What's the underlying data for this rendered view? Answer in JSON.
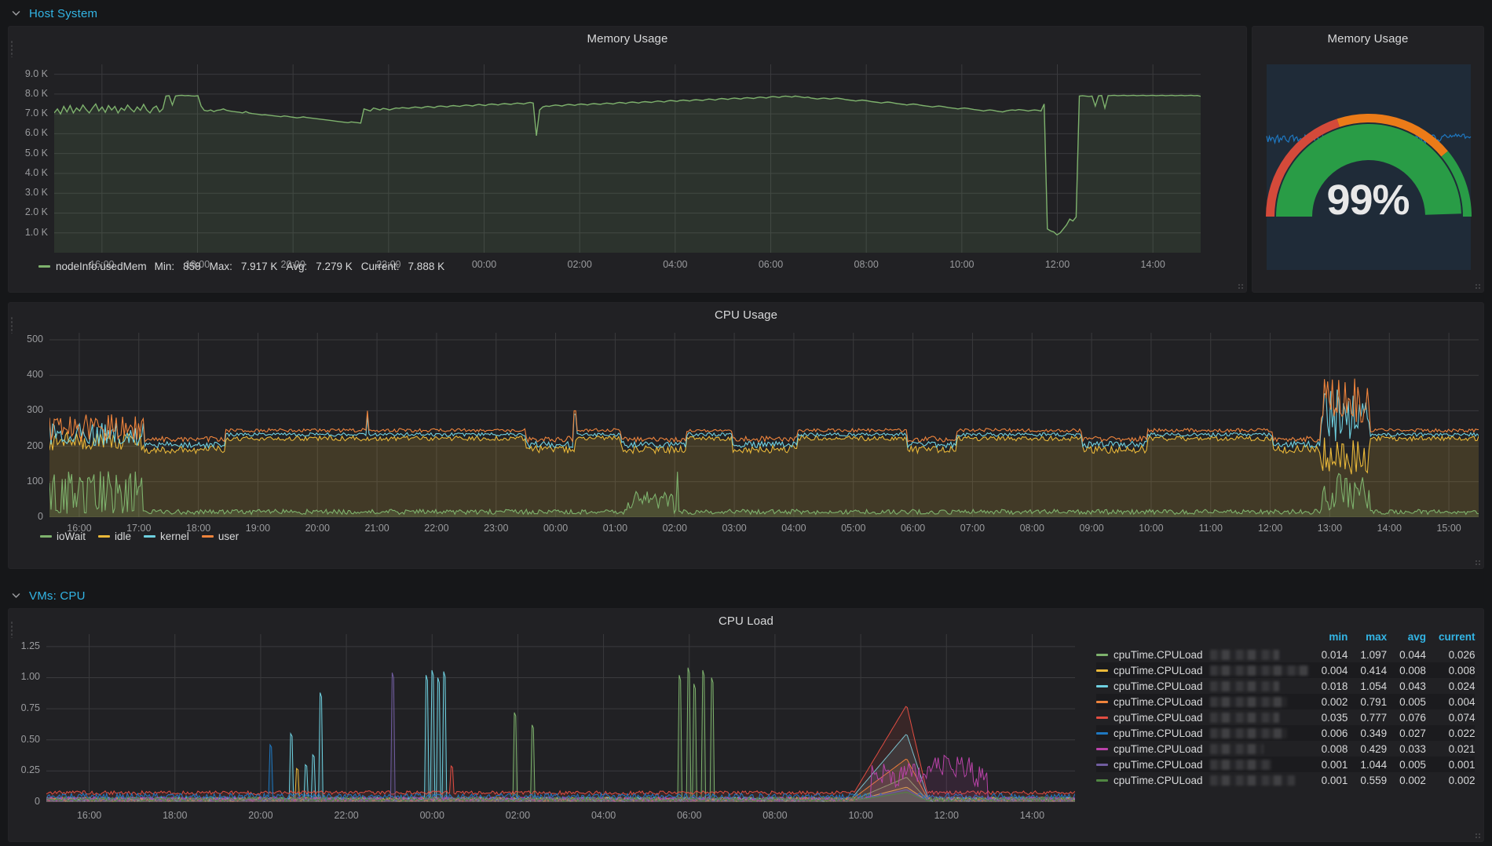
{
  "rows": [
    {
      "title": "Host System",
      "icon": "chevron-down-icon"
    },
    {
      "title": "VMs: CPU",
      "icon": "chevron-down-icon"
    }
  ],
  "panels": {
    "memory_graph": {
      "title": "Memory Usage",
      "legend": {
        "series": "nodeInfo.usedMem",
        "color": "#7eb26d",
        "min_label": "Min:",
        "min": "858",
        "max_label": "Max:",
        "max": "7.917 K",
        "avg_label": "Avg:",
        "avg": "7.279 K",
        "current_label": "Current:",
        "current": "7.888 K"
      }
    },
    "memory_gauge": {
      "title": "Memory Usage",
      "value": "99%",
      "percent": 99,
      "colors": {
        "ok": "#299c46",
        "warn": "#eb7b18",
        "crit": "#d44a3a",
        "background": "#1f2b38"
      }
    },
    "cpu_usage": {
      "title": "CPU Usage",
      "legend": [
        {
          "label": "ioWait",
          "color": "#7eb26d"
        },
        {
          "label": "idle",
          "color": "#eab839"
        },
        {
          "label": "kernel",
          "color": "#6ed0e0"
        },
        {
          "label": "user",
          "color": "#ef843c"
        }
      ]
    },
    "cpu_load": {
      "title": "CPU Load",
      "legend_headers": [
        "min",
        "max",
        "avg",
        "current"
      ],
      "legend_series_prefix": "cpuTime.CPULoad",
      "legend_rows": [
        {
          "prefix": "cpuTime.CPULoad",
          "redacted_width": 88,
          "color": "#7eb26d",
          "min": "0.014",
          "max": "1.097",
          "avg": "0.044",
          "current": "0.026"
        },
        {
          "prefix": "cpuTime.CPULoad",
          "redacted_width": 126,
          "color": "#eab839",
          "min": "0.004",
          "max": "0.414",
          "avg": "0.008",
          "current": "0.008"
        },
        {
          "prefix": "cpuTime.CPULoad",
          "redacted_width": 88,
          "color": "#6ed0e0",
          "min": "0.018",
          "max": "1.054",
          "avg": "0.043",
          "current": "0.024"
        },
        {
          "prefix": "cpuTime.CPULoad",
          "redacted_width": 98,
          "color": "#ef843c",
          "min": "0.002",
          "max": "0.791",
          "avg": "0.005",
          "current": "0.004"
        },
        {
          "prefix": "cpuTime.CPULoad",
          "redacted_width": 88,
          "color": "#e24d42",
          "min": "0.035",
          "max": "0.777",
          "avg": "0.076",
          "current": "0.074"
        },
        {
          "prefix": "cpuTime.CPULoad",
          "redacted_width": 98,
          "color": "#1f78c1",
          "min": "0.006",
          "max": "0.349",
          "avg": "0.027",
          "current": "0.022"
        },
        {
          "prefix": "cpuTime.CPULoad",
          "redacted_width": 68,
          "color": "#ba43a9",
          "min": "0.008",
          "max": "0.429",
          "avg": "0.033",
          "current": "0.021"
        },
        {
          "prefix": "cpuTime.CPULoad",
          "redacted_width": 78,
          "color": "#705da0",
          "min": "0.001",
          "max": "1.044",
          "avg": "0.005",
          "current": "0.001"
        },
        {
          "prefix": "cpuTime.CPULoad",
          "redacted_width": 108,
          "color": "#508642",
          "min": "0.001",
          "max": "0.559",
          "avg": "0.002",
          "current": "0.002"
        }
      ]
    }
  },
  "chart_data": [
    {
      "id": "memory_graph",
      "type": "line",
      "title": "Memory Usage",
      "ylabel": "",
      "xlabel": "",
      "ylim": [
        0,
        9500
      ],
      "ytick_labels": [
        "9.0 K",
        "8.0 K",
        "7.0 K",
        "6.0 K",
        "5.0 K",
        "4.0 K",
        "3.0 K",
        "2.0 K",
        "1.0 K"
      ],
      "ytick_values": [
        9000,
        8000,
        7000,
        6000,
        5000,
        4000,
        3000,
        2000,
        1000
      ],
      "xtick_labels": [
        "16:00",
        "18:00",
        "20:00",
        "22:00",
        "00:00",
        "02:00",
        "04:00",
        "06:00",
        "08:00",
        "10:00",
        "12:00",
        "14:00"
      ],
      "grid": true,
      "legend_position": "bottom",
      "series": [
        {
          "name": "nodeInfo.usedMem",
          "color": "#7eb26d",
          "fill": true,
          "values": [
            7050,
            7250,
            7000,
            7380,
            7100,
            7420,
            7050,
            7300,
            7150,
            7450,
            7220,
            7050,
            7300,
            7500,
            7150,
            7350,
            7080,
            7420,
            7200,
            7380,
            7050,
            7300,
            7180,
            7450,
            7250,
            7100,
            7350,
            7180,
            7480,
            7200,
            7050,
            7300,
            7400,
            7100,
            7250,
            7900,
            7920,
            7450,
            7900,
            7930,
            7940,
            7920,
            7930,
            7910,
            7900,
            7920,
            7400,
            7180,
            7150,
            7200,
            7120,
            7180,
            7200,
            7250,
            7180,
            7150,
            7120,
            7100,
            7080,
            7050,
            7120,
            7050,
            7020,
            7000,
            6980,
            6950,
            6960,
            6940,
            6920,
            6900,
            6880,
            6860,
            6900,
            6880,
            6850,
            6830,
            6800,
            6820,
            6850,
            6820,
            6800,
            6780,
            6760,
            6740,
            6720,
            6700,
            6680,
            6660,
            6640,
            6620,
            6600,
            6580,
            6560,
            6600,
            6580,
            6560,
            6540,
            7250,
            7200,
            7150,
            7300,
            7250,
            7200,
            7280,
            7250,
            7200,
            7250,
            7300,
            7280,
            7320,
            7300,
            7280,
            7320,
            7350,
            7330,
            7300,
            7350,
            7380,
            7350,
            7320,
            7380,
            7400,
            7380,
            7350,
            7400,
            7420,
            7400,
            7380,
            7420,
            7450,
            7430,
            7400,
            7450,
            7480,
            7450,
            7420,
            7480,
            7500,
            7480,
            7450,
            7500,
            7520,
            7500,
            7480,
            7520,
            7550,
            7530,
            7500,
            7550,
            7580,
            7550,
            5900,
            7200,
            7350,
            7400,
            7380,
            7420,
            7450,
            7430,
            7400,
            7450,
            7480,
            7460,
            7430,
            7480,
            7500,
            7480,
            7450,
            7500,
            7520,
            7500,
            7480,
            7520,
            7550,
            7530,
            7500,
            7550,
            7580,
            7560,
            7530,
            7580,
            7600,
            7580,
            7550,
            7600,
            7620,
            7600,
            7580,
            7620,
            7650,
            7630,
            7600,
            7650,
            7680,
            7660,
            7630,
            7680,
            7700,
            7680,
            7650,
            7700,
            7720,
            7700,
            7680,
            7720,
            7750,
            7730,
            7700,
            7750,
            7780,
            7760,
            7730,
            7780,
            7800,
            7780,
            7750,
            7800,
            7820,
            7800,
            7780,
            7820,
            7850,
            7830,
            7800,
            7850,
            7880,
            7860,
            7830,
            7880,
            7900,
            7880,
            7850,
            7900,
            7880,
            7850,
            7820,
            7850,
            7800,
            7780,
            7750,
            7780,
            7800,
            7780,
            7750,
            7780,
            7800,
            7780,
            7750,
            7720,
            7700,
            7680,
            7650,
            7680,
            7700,
            7680,
            7650,
            7620,
            7600,
            7580,
            7550,
            7580,
            7600,
            7580,
            7550,
            7520,
            7500,
            7480,
            7450,
            7480,
            7500,
            7480,
            7450,
            7420,
            7400,
            7380,
            7350,
            7380,
            7400,
            7380,
            7350,
            7320,
            7300,
            7280,
            7250,
            7280,
            7300,
            7280,
            7250,
            7220,
            7200,
            7180,
            7150,
            7180,
            7200,
            7180,
            7150,
            7120,
            7100,
            7150,
            7180,
            7200,
            7180,
            7220,
            7200,
            7180,
            7150,
            7180,
            7200,
            7180,
            7150,
            7500,
            1200,
            1100,
            1050,
            900,
            1000,
            1200,
            1400,
            1700,
            1600,
            1800,
            7900,
            7920,
            7900,
            7880,
            7900,
            7400,
            7910,
            7930,
            7300,
            7920,
            7930,
            7940,
            7920,
            7930,
            7940,
            7920,
            7930,
            7940,
            7920,
            7930,
            7940,
            7920,
            7930,
            7940,
            7920,
            7930,
            7940,
            7920,
            7930,
            7940,
            7920,
            7930,
            7940,
            7920,
            7930,
            7940,
            7920,
            7930,
            7888
          ]
        }
      ]
    },
    {
      "id": "memory_gauge",
      "type": "gauge",
      "title": "Memory Usage",
      "value": 99,
      "unit": "%",
      "min": 0,
      "max": 100,
      "thresholds": [
        {
          "from": 0,
          "color": "#d44a3a"
        },
        {
          "from": 80,
          "color": "#eb7b18"
        },
        {
          "from": 95,
          "color": "#299c46"
        }
      ]
    },
    {
      "id": "cpu_usage",
      "type": "area",
      "title": "CPU Usage",
      "ylim": [
        0,
        520
      ],
      "ytick_labels": [
        "500",
        "400",
        "300",
        "200",
        "100",
        "0"
      ],
      "ytick_values": [
        500,
        400,
        300,
        200,
        100,
        0
      ],
      "xtick_labels": [
        "16:00",
        "17:00",
        "18:00",
        "19:00",
        "20:00",
        "21:00",
        "22:00",
        "23:00",
        "00:00",
        "01:00",
        "02:00",
        "03:00",
        "04:00",
        "05:00",
        "06:00",
        "07:00",
        "08:00",
        "09:00",
        "10:00",
        "11:00",
        "12:00",
        "13:00",
        "14:00",
        "15:00"
      ],
      "grid": true,
      "legend_position": "bottom",
      "series": [
        {
          "name": "ioWait",
          "color": "#7eb26d",
          "fill": true,
          "avg_level": 18,
          "max_level": 130
        },
        {
          "name": "idle",
          "color": "#eab839",
          "fill": true,
          "avg_level": 218,
          "max_level": 300
        },
        {
          "name": "kernel",
          "color": "#6ed0e0",
          "fill": false,
          "avg_level": 228,
          "max_level": 300
        },
        {
          "name": "user",
          "color": "#ef843c",
          "fill": false,
          "avg_level": 240,
          "max_level": 400
        }
      ]
    },
    {
      "id": "cpu_load",
      "type": "line",
      "title": "CPU Load",
      "ylim": [
        0,
        1.35
      ],
      "ytick_labels": [
        "1.25",
        "1.00",
        "0.75",
        "0.50",
        "0.25",
        "0"
      ],
      "ytick_values": [
        1.25,
        1.0,
        0.75,
        0.5,
        0.25,
        0
      ],
      "xtick_labels": [
        "16:00",
        "18:00",
        "20:00",
        "22:00",
        "00:00",
        "02:00",
        "04:00",
        "06:00",
        "08:00",
        "10:00",
        "12:00",
        "14:00"
      ],
      "grid": true,
      "legend_position": "right",
      "series": [
        {
          "name": "cpuTime.CPULoad",
          "color": "#7eb26d",
          "min": 0.014,
          "max": 1.097,
          "avg": 0.044,
          "current": 0.026
        },
        {
          "name": "cpuTime.CPULoad",
          "color": "#eab839",
          "min": 0.004,
          "max": 0.414,
          "avg": 0.008,
          "current": 0.008
        },
        {
          "name": "cpuTime.CPULoad",
          "color": "#6ed0e0",
          "min": 0.018,
          "max": 1.054,
          "avg": 0.043,
          "current": 0.024
        },
        {
          "name": "cpuTime.CPULoad",
          "color": "#ef843c",
          "min": 0.002,
          "max": 0.791,
          "avg": 0.005,
          "current": 0.004
        },
        {
          "name": "cpuTime.CPULoad",
          "color": "#e24d42",
          "min": 0.035,
          "max": 0.777,
          "avg": 0.076,
          "current": 0.074
        },
        {
          "name": "cpuTime.CPULoad",
          "color": "#1f78c1",
          "min": 0.006,
          "max": 0.349,
          "avg": 0.027,
          "current": 0.022
        },
        {
          "name": "cpuTime.CPULoad",
          "color": "#ba43a9",
          "min": 0.008,
          "max": 0.429,
          "avg": 0.033,
          "current": 0.021
        },
        {
          "name": "cpuTime.CPULoad",
          "color": "#705da0",
          "min": 0.001,
          "max": 1.044,
          "avg": 0.005,
          "current": 0.001
        },
        {
          "name": "cpuTime.CPULoad",
          "color": "#508642",
          "min": 0.001,
          "max": 0.559,
          "avg": 0.002,
          "current": 0.002
        }
      ]
    }
  ]
}
